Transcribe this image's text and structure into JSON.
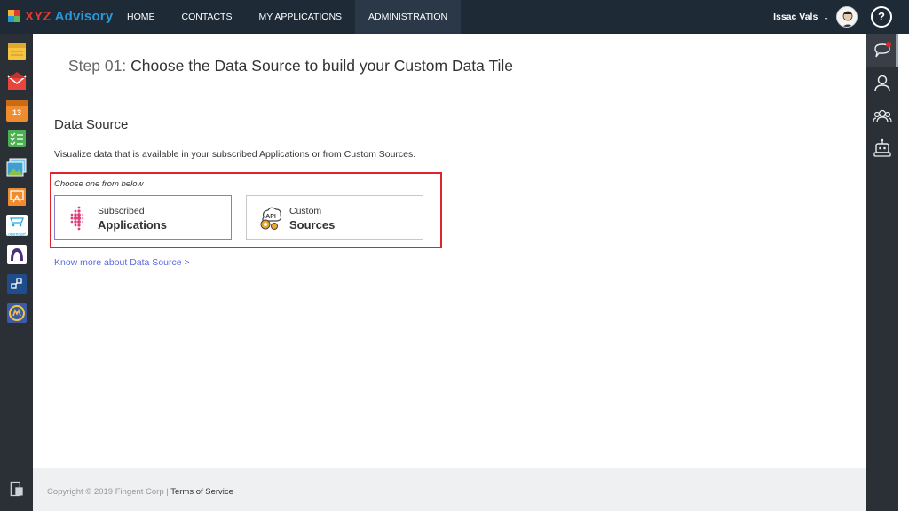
{
  "brand": {
    "prefix": "XYZ",
    "name": "Advisory"
  },
  "nav": {
    "items": [
      {
        "label": "HOME"
      },
      {
        "label": "CONTACTS"
      },
      {
        "label": "MY APPLICATIONS"
      },
      {
        "label": "ADMINISTRATION",
        "active": true
      }
    ]
  },
  "user": {
    "name": "Issac Vals"
  },
  "help": {
    "label": "?"
  },
  "left_rail": {
    "icons": [
      "notes-icon",
      "mail-icon",
      "calendar-icon",
      "checklist-icon",
      "photos-icon",
      "certificate-icon",
      "opencart-icon",
      "arch-app-icon",
      "workflow-icon",
      "clock-badge-icon"
    ],
    "opencart_label": "opencart",
    "calendar_day": "13",
    "bottom_icon": "exit-icon"
  },
  "right_rail": {
    "icons": [
      "chat-icon",
      "user-icon",
      "team-icon",
      "bot-icon"
    ]
  },
  "page": {
    "step": "Step 01:",
    "title": "Choose the Data Source to build your Custom Data Tile"
  },
  "section": {
    "title": "Data Source",
    "description": "Visualize data that is available in your subscribed Applications or from Custom Sources.",
    "choose_label": "Choose one from below",
    "options": [
      {
        "line1": "Subscribed",
        "line2": "Applications",
        "selected": true
      },
      {
        "line1": "Custom",
        "line2": "Sources",
        "selected": false
      }
    ],
    "api_badge": "API",
    "know_more": "Know more about Data Source >"
  },
  "footer": {
    "copyright": "Copyright © 2019 Fingent Corp | ",
    "terms": "Terms of Service"
  },
  "colors": {
    "topbar": "#1e2a36",
    "rail": "#2b2f36",
    "highlight": "#e0252a",
    "link": "#5b6cdb",
    "brand_blue": "#2a97d6",
    "brand_red": "#e13a2f"
  }
}
